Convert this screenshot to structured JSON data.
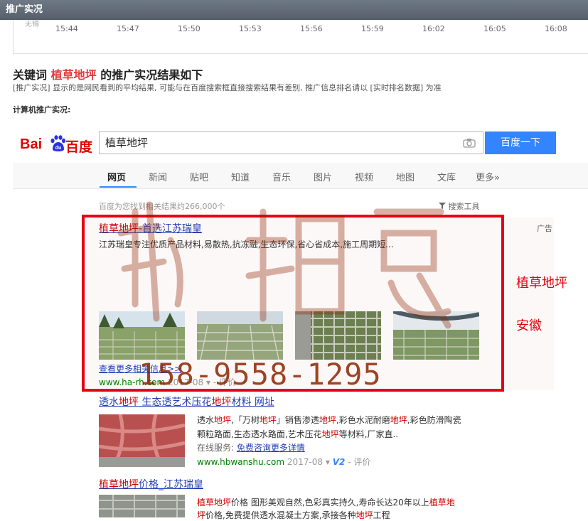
{
  "header": {
    "title": "推广实况"
  },
  "timeline": {
    "cutoff_label": "无锡",
    "ticks": [
      "15:44",
      "15:47",
      "15:50",
      "15:53",
      "15:56",
      "15:59",
      "16:02",
      "16:05",
      "16:08"
    ]
  },
  "report": {
    "title_prefix": "关键词",
    "keyword": "植草地坪",
    "title_suffix": "的推广实况结果如下",
    "note": "[推广实况] 显示的是网民看到的平均结果, 可能与在百度搜索框直接搜索结果有差别, 推广信息排名请以 [实时排名数据] 为准",
    "device_label": "计算机推广实况:"
  },
  "baidu": {
    "logo_bai": "Bai",
    "logo_du": "du",
    "logo_cn": "百度",
    "search_value": "植草地坪",
    "search_button": "百度一下",
    "tabs": [
      "网页",
      "新闻",
      "贴吧",
      "知道",
      "音乐",
      "图片",
      "视频",
      "地图",
      "文库",
      "更多»"
    ],
    "result_count": "百度为您找到相关结果约266,000个",
    "tools_label": "搜索工具"
  },
  "ad": {
    "title_kw": "植草地坪",
    "title_rest": "-首选江苏瑞皇",
    "tag": "广告",
    "desc": "江苏瑞皇专注优质产品材料,易散热,抗冻融,生态环保,省心省成本,施工周期短...",
    "more": "查看更多相关信息>>",
    "url": "www.ha-rh.com",
    "date": "2017-08",
    "eval": "评价"
  },
  "result2": {
    "title_a": "透水",
    "title_kw1": "地坪",
    "title_b": " 生态透艺术压花",
    "title_kw2": "地坪",
    "title_c": "材料 网址",
    "line1_a": "透水",
    "line1_kw1": "地坪",
    "line1_b": ",「万树",
    "line1_kw2": "地坪",
    "line1_c": "」销售渗透",
    "line1_kw3": "地坪",
    "line1_d": ",彩色水泥耐磨",
    "line1_kw4": "地坪",
    "line1_e": ",彩色防滑陶瓷",
    "line2_a": "颗粒路面,生态透水路面,艺术压花",
    "line2_kw": "地坪",
    "line2_b": "等材料,厂家直..",
    "service_label": "在线服务:",
    "service_link": "免费咨询更多详情",
    "url": "www.hbwanshu.com",
    "date": "2017-08",
    "badge": "V2",
    "eval": "评价"
  },
  "result3": {
    "title_kw": "植草地坪",
    "title_rest": "价格_江苏瑞皇",
    "line1_kw1": "植草地坪",
    "line1_a": "价格 图形美观自然,色彩真实持久,寿命长达20年以上",
    "line1_kw2": "植草地",
    "line2_kw": "坪",
    "line2_a": "价格,免费提供透水混凝土方案,承接各种",
    "line2_kw2": "地坪",
    "line2_b": "工程"
  },
  "overlay": {
    "side_label_1": "植草地坪",
    "side_label_2": "安徽",
    "phone": "158-9558-1295"
  },
  "colors": {
    "accent": "#3385ff",
    "ad_border": "#e60012",
    "link": "#2440b3",
    "keyword": "#c00",
    "url": "#008000"
  }
}
